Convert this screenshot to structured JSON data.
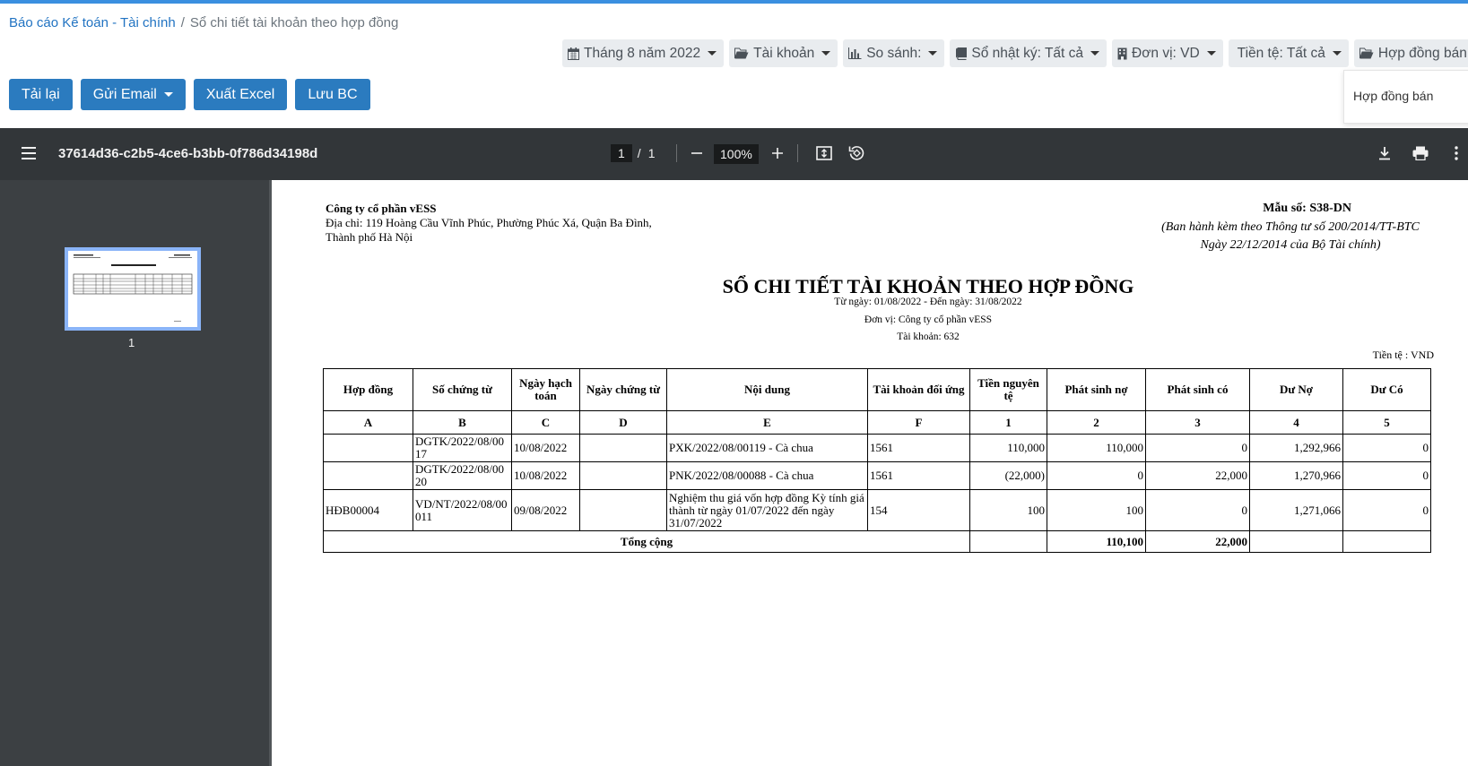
{
  "breadcrumb": {
    "parent": "Báo cáo Kế toán - Tài chính",
    "current": "Sổ chi tiết tài khoản theo hợp đồng"
  },
  "filters": {
    "period": "Tháng 8 năm 2022",
    "account": "Tài khoản",
    "compare": "So sánh:",
    "journal": "Sổ nhật ký: Tất cả",
    "unit": "Đơn vị: VD",
    "currency": "Tiền tệ: Tất cả",
    "contract": "Hợp đồng bán"
  },
  "contract_dropdown": {
    "option": "Hợp đồng bán"
  },
  "actions": {
    "reload": "Tải lại",
    "email": "Gửi Email",
    "excel": "Xuất Excel",
    "save": "Lưu BC"
  },
  "viewer": {
    "doc_title": "37614d36-c2b5-4ce6-b3bb-0f786d34198d",
    "page_current": "1",
    "page_sep": "/",
    "page_total": "1",
    "zoom": "100%",
    "thumb_label": "1"
  },
  "report": {
    "company": "Công ty cổ phần vESS",
    "address": "Địa chỉ: 119 Hoàng Cầu Vĩnh Phúc, Phường Phúc Xá, Quận Ba Đình, Thành phố Hà Nội",
    "form_no": "Mẫu số: S38-DN",
    "form_note_1": "(Ban hành kèm theo Thông tư số 200/2014/TT-BTC",
    "form_note_2": "Ngày 22/12/2014 của Bộ Tài chính)",
    "title": "SỔ CHI TIẾT TÀI KHOẢN THEO HỢP ĐỒNG",
    "date_range": "Từ ngày: 01/08/2022 - Đến ngày: 31/08/2022",
    "unit": "Đơn vị: Công ty cổ phần vESS",
    "account": "Tài khoản: 632",
    "currency": "Tiền tệ : VND",
    "headers": [
      "Hợp đồng",
      "Số chứng từ",
      "Ngày hạch toán",
      "Ngày chứng từ",
      "Nội dung",
      "Tài khoản đối ứng",
      "Tiền nguyên tệ",
      "Phát sinh nợ",
      "Phát sinh có",
      "Dư Nợ",
      "Dư Có"
    ],
    "index_row": [
      "A",
      "B",
      "C",
      "D",
      "E",
      "F",
      "1",
      "2",
      "3",
      "4",
      "5"
    ],
    "rows": [
      [
        "",
        "DGTK/2022/08/0017",
        "10/08/2022",
        "",
        "PXK/2022/08/00119 - Cà chua",
        "1561",
        "110,000",
        "110,000",
        "0",
        "1,292,966",
        "0"
      ],
      [
        "",
        "DGTK/2022/08/0020",
        "10/08/2022",
        "",
        "PNK/2022/08/00088 - Cà chua",
        "1561",
        "(22,000)",
        "0",
        "22,000",
        "1,270,966",
        "0"
      ],
      [
        "HĐB00004",
        "VD/NT/2022/08/00011",
        "09/08/2022",
        "",
        "Nghiệm thu giá vốn hợp đồng Kỳ tính giá thành từ ngày 01/07/2022 đến ngày 31/07/2022",
        "154",
        "100",
        "100",
        "0",
        "1,271,066",
        "0"
      ]
    ],
    "total": {
      "label": "Tổng cộng",
      "debit": "110,100",
      "credit": "22,000"
    }
  }
}
